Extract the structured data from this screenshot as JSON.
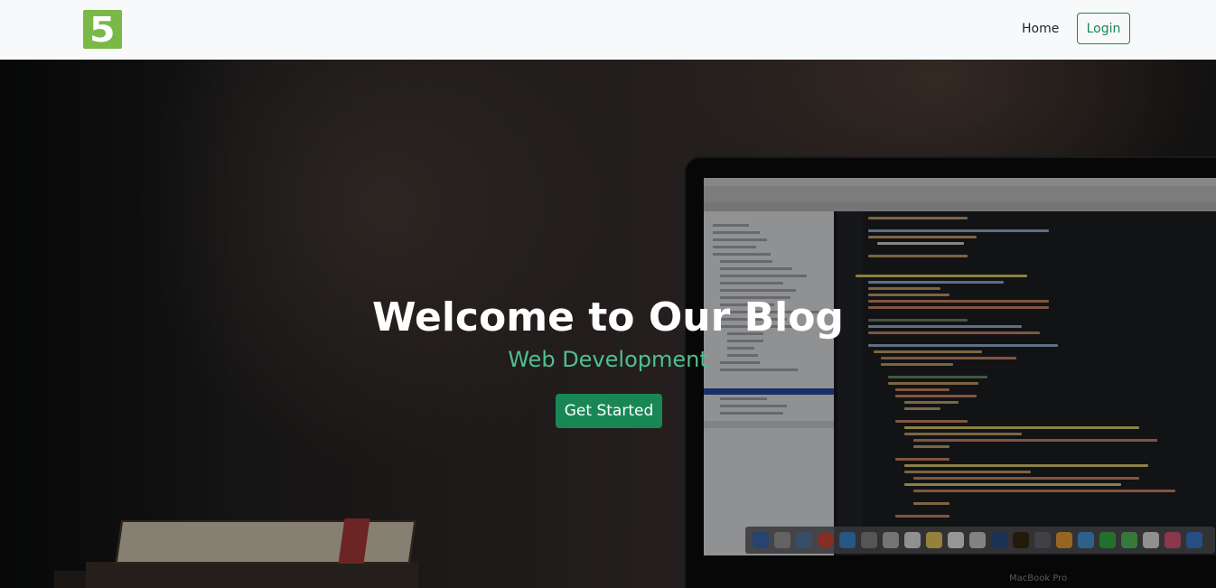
{
  "navbar": {
    "logo_text": "5",
    "home_label": "Home",
    "login_label": "Login"
  },
  "hero": {
    "title": "Welcome to Our Blog",
    "subtitle": "Web Development",
    "button_label": "Get Started",
    "laptop_brand": "MacBook Pro"
  },
  "colors": {
    "brand_logo": "#7ab847",
    "primary": "#198754",
    "subtitle": "#4fbf8e",
    "navbar_bg": "#f8f9fa"
  }
}
